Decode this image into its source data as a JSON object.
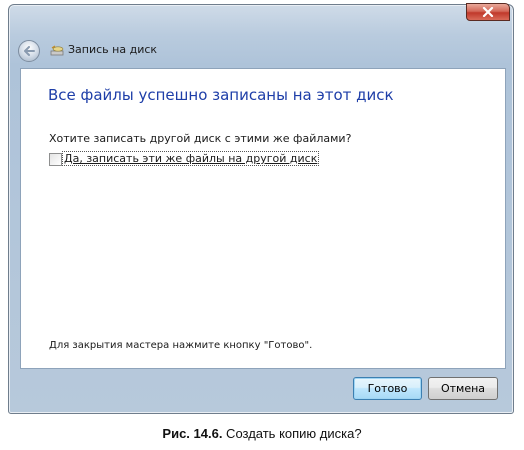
{
  "window": {
    "title": "Запись на диск",
    "close_symbol": "x",
    "back_icon": "back-arrow-icon",
    "title_icon": "burn-disc-icon"
  },
  "content": {
    "heading": "Все файлы успешно записаны на этот диск",
    "question": "Хотите записать другой диск с этими же файлами?",
    "checkbox_label": "Да, записать эти же файлы на другой диск",
    "checkbox_checked": false,
    "hint": "Для закрытия мастера нажмите кнопку \"Готово\"."
  },
  "buttons": {
    "done": "Готово",
    "cancel": "Отмена"
  },
  "caption": {
    "label": "Рис. 14.6.",
    "text": " Создать копию диска?"
  }
}
